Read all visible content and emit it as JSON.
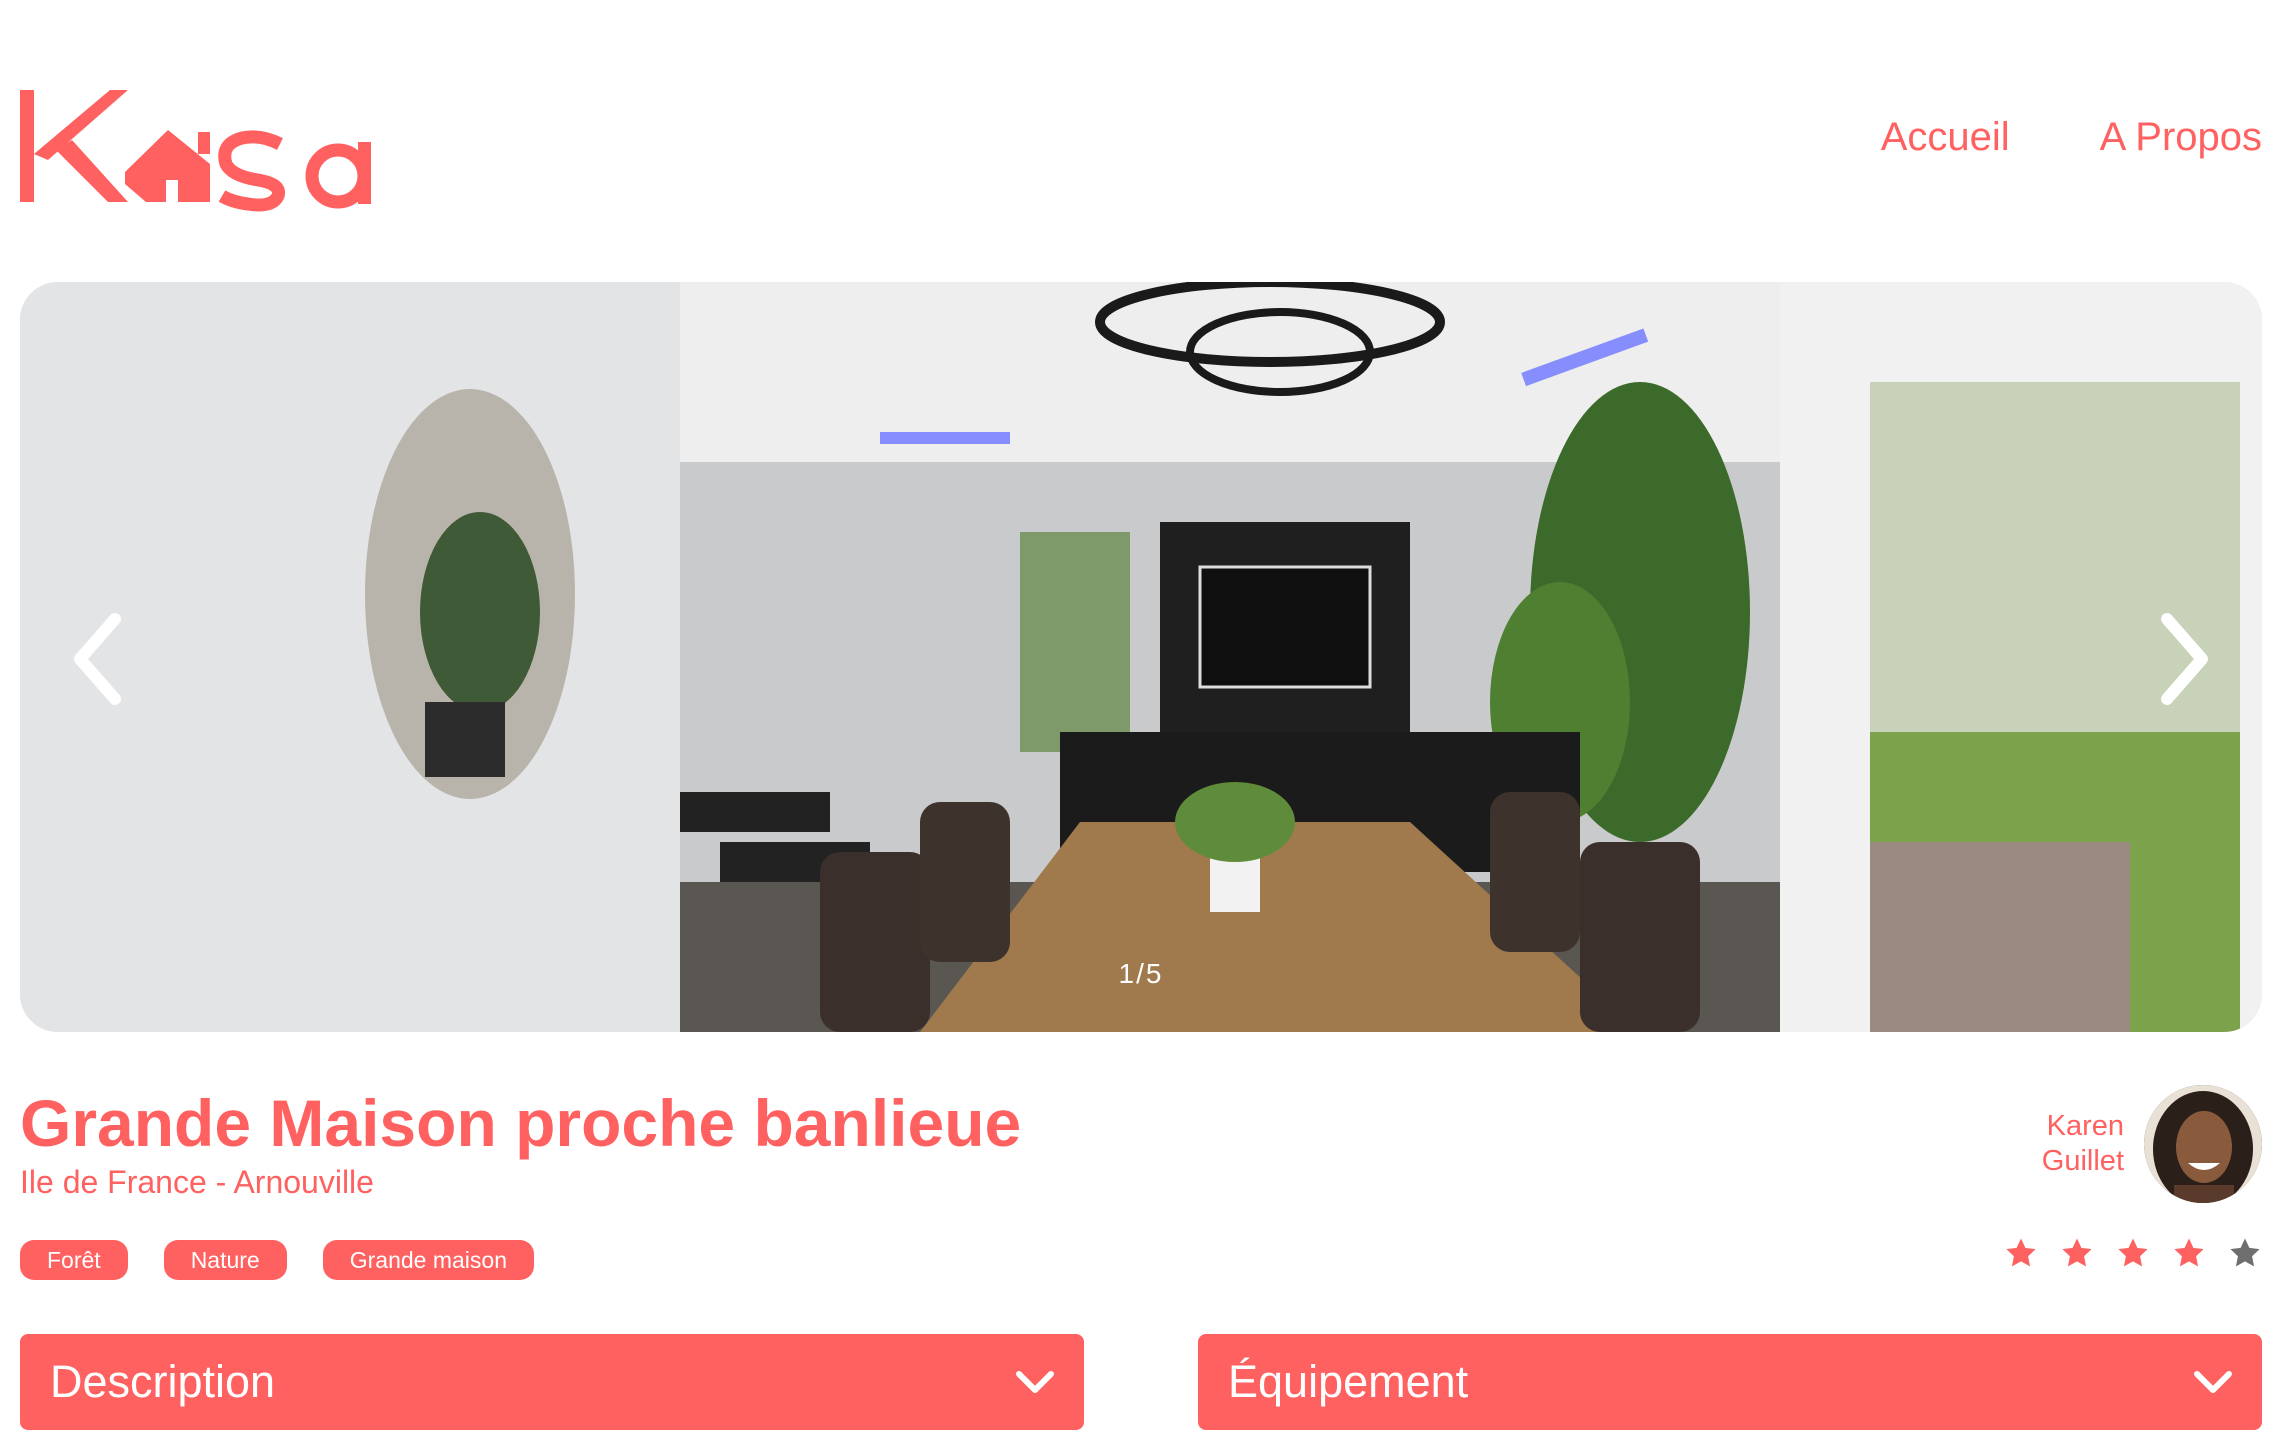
{
  "header": {
    "logo_text": "Kasa",
    "nav": [
      {
        "label": "Accueil"
      },
      {
        "label": "A Propos"
      }
    ]
  },
  "gallery": {
    "counter": "1/5",
    "current": 1,
    "total": 5,
    "prev_icon": "chevron-left-icon",
    "next_icon": "chevron-right-icon"
  },
  "listing": {
    "title": "Grande Maison proche banlieue",
    "location": "Ile de France - Arnouville",
    "tags": [
      "Forêt",
      "Nature",
      "Grande maison"
    ],
    "host": {
      "first_name": "Karen",
      "last_name": "Guillet"
    },
    "rating": 4,
    "rating_max": 5
  },
  "collapses": [
    {
      "label": "Description"
    },
    {
      "label": "Équipement"
    }
  ],
  "colors": {
    "accent": "#FF6060",
    "star_inactive": "#6E6E6E",
    "white": "#FFFFFF"
  }
}
